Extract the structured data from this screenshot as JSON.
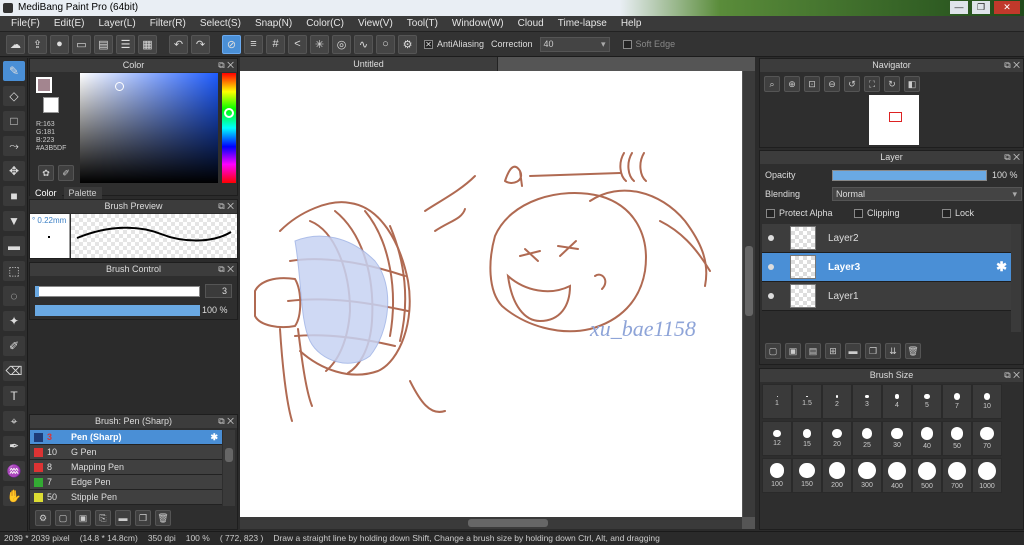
{
  "title": "MediBang Paint Pro (64bit)",
  "menu": [
    "File(F)",
    "Edit(E)",
    "Layer(L)",
    "Filter(R)",
    "Select(S)",
    "Snap(N)",
    "Color(C)",
    "View(V)",
    "Tool(T)",
    "Window(W)",
    "Cloud",
    "Time-lapse",
    "Help"
  ],
  "toolbar": {
    "antialias": "AntiAliasing",
    "correction_label": "Correction",
    "correction_value": "40",
    "soft_edge": "Soft Edge"
  },
  "color_panel": {
    "title": "Color",
    "rgb": [
      "R:163",
      "G:181",
      "B:223",
      "#A3B5DF"
    ],
    "tabs": [
      "Color",
      "Palette"
    ],
    "fg": "#a3858f"
  },
  "brush_preview": {
    "title": "Brush Preview",
    "size": "0.22mm"
  },
  "brush_control": {
    "title": "Brush Control",
    "size_value": "3",
    "opacity_value": "100 %",
    "size_fraction": 0.02,
    "opacity_fraction": 1.0
  },
  "brush_list": {
    "title": "Brush: Pen (Sharp)",
    "items": [
      {
        "num": "3",
        "name": "Pen (Sharp)",
        "color": "#1e3c78"
      },
      {
        "num": "10",
        "name": "G Pen",
        "color": "#d33"
      },
      {
        "num": "8",
        "name": "Mapping Pen",
        "color": "#d33"
      },
      {
        "num": "7",
        "name": "Edge Pen",
        "color": "#3a3"
      },
      {
        "num": "50",
        "name": "Stipple Pen",
        "color": "#dd3"
      }
    ]
  },
  "document": {
    "tab": "Untitled",
    "signature": "xu_bae1158"
  },
  "navigator": {
    "title": "Navigator"
  },
  "layer_panel": {
    "title": "Layer",
    "opacity_label": "Opacity",
    "opacity_value": "100 %",
    "blending_label": "Blending",
    "blending_value": "Normal",
    "protect_alpha": "Protect Alpha",
    "clipping": "Clipping",
    "lock": "Lock",
    "layers": [
      "Layer2",
      "Layer3",
      "Layer1"
    ]
  },
  "brush_size": {
    "title": "Brush Size",
    "sizes": [
      "1",
      "1.5",
      "2",
      "3",
      "4",
      "5",
      "7",
      "10",
      "12",
      "15",
      "20",
      "25",
      "30",
      "40",
      "50",
      "70",
      "100",
      "150",
      "200",
      "300",
      "400",
      "500",
      "700",
      "1000"
    ]
  },
  "status": {
    "dims": "2039 * 2039 pixel",
    "cm": "(14.8 * 14.8cm)",
    "dpi": "350 dpi",
    "zoom": "100 %",
    "coords": "( 772, 823 )",
    "hint": "Draw a straight line by holding down Shift, Change a brush size by holding down Ctrl, Alt, and dragging"
  }
}
